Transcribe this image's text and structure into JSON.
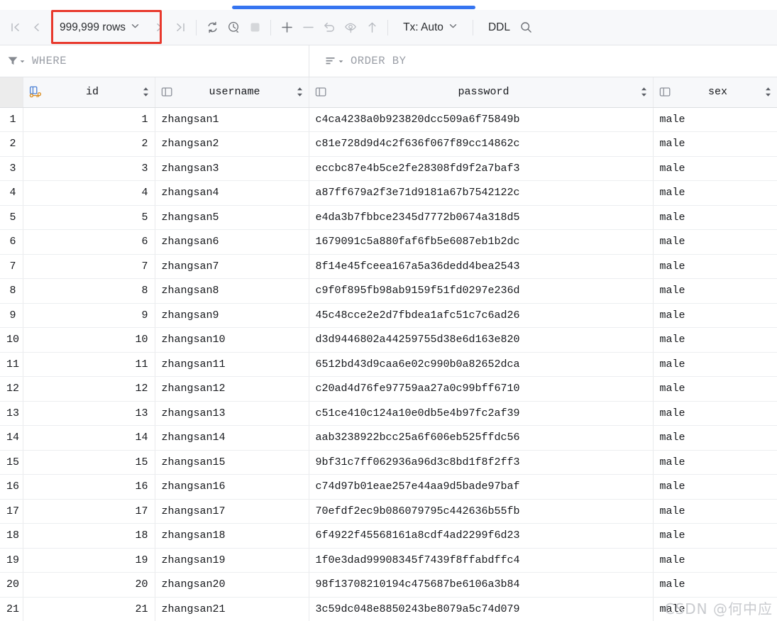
{
  "toolbar": {
    "nav_first": "first-page",
    "nav_prev": "previous-page",
    "rows_label": "999,999 rows",
    "rows_caret": "⌄",
    "nav_next": "next-page",
    "nav_last": "last-page",
    "refresh": "refresh",
    "history": "history",
    "stop": "stop",
    "add_row": "+",
    "remove_row": "−",
    "revert": "revert",
    "preview": "preview-changes",
    "submit": "submit",
    "tx_label": "Tx: Auto",
    "tx_caret": "⌄",
    "ddl_label": "DDL",
    "search": "search",
    "highlight_color": "#e8382c",
    "progress_color": "#3574f0"
  },
  "filters": {
    "where_label": "WHERE",
    "order_by_label": "ORDER BY"
  },
  "table": {
    "gutter_header": "",
    "columns": [
      {
        "name": "id",
        "icon": "primary-key-icon",
        "sortable": true,
        "align": "right"
      },
      {
        "name": "username",
        "icon": "column-icon",
        "sortable": true,
        "align": "left"
      },
      {
        "name": "password",
        "icon": "column-icon",
        "sortable": true,
        "align": "left"
      },
      {
        "name": "sex",
        "icon": "column-icon",
        "sortable": true,
        "align": "left"
      }
    ],
    "rows": [
      {
        "n": "1",
        "id": "1",
        "username": "zhangsan1",
        "password": "c4ca4238a0b923820dcc509a6f75849b",
        "sex": "male"
      },
      {
        "n": "2",
        "id": "2",
        "username": "zhangsan2",
        "password": "c81e728d9d4c2f636f067f89cc14862c",
        "sex": "male"
      },
      {
        "n": "3",
        "id": "3",
        "username": "zhangsan3",
        "password": "eccbc87e4b5ce2fe28308fd9f2a7baf3",
        "sex": "male"
      },
      {
        "n": "4",
        "id": "4",
        "username": "zhangsan4",
        "password": "a87ff679a2f3e71d9181a67b7542122c",
        "sex": "male"
      },
      {
        "n": "5",
        "id": "5",
        "username": "zhangsan5",
        "password": "e4da3b7fbbce2345d7772b0674a318d5",
        "sex": "male"
      },
      {
        "n": "6",
        "id": "6",
        "username": "zhangsan6",
        "password": "1679091c5a880faf6fb5e6087eb1b2dc",
        "sex": "male"
      },
      {
        "n": "7",
        "id": "7",
        "username": "zhangsan7",
        "password": "8f14e45fceea167a5a36dedd4bea2543",
        "sex": "male"
      },
      {
        "n": "8",
        "id": "8",
        "username": "zhangsan8",
        "password": "c9f0f895fb98ab9159f51fd0297e236d",
        "sex": "male"
      },
      {
        "n": "9",
        "id": "9",
        "username": "zhangsan9",
        "password": "45c48cce2e2d7fbdea1afc51c7c6ad26",
        "sex": "male"
      },
      {
        "n": "10",
        "id": "10",
        "username": "zhangsan10",
        "password": "d3d9446802a44259755d38e6d163e820",
        "sex": "male"
      },
      {
        "n": "11",
        "id": "11",
        "username": "zhangsan11",
        "password": "6512bd43d9caa6e02c990b0a82652dca",
        "sex": "male"
      },
      {
        "n": "12",
        "id": "12",
        "username": "zhangsan12",
        "password": "c20ad4d76fe97759aa27a0c99bff6710",
        "sex": "male"
      },
      {
        "n": "13",
        "id": "13",
        "username": "zhangsan13",
        "password": "c51ce410c124a10e0db5e4b97fc2af39",
        "sex": "male"
      },
      {
        "n": "14",
        "id": "14",
        "username": "zhangsan14",
        "password": "aab3238922bcc25a6f606eb525ffdc56",
        "sex": "male"
      },
      {
        "n": "15",
        "id": "15",
        "username": "zhangsan15",
        "password": "9bf31c7ff062936a96d3c8bd1f8f2ff3",
        "sex": "male"
      },
      {
        "n": "16",
        "id": "16",
        "username": "zhangsan16",
        "password": "c74d97b01eae257e44aa9d5bade97baf",
        "sex": "male"
      },
      {
        "n": "17",
        "id": "17",
        "username": "zhangsan17",
        "password": "70efdf2ec9b086079795c442636b55fb",
        "sex": "male"
      },
      {
        "n": "18",
        "id": "18",
        "username": "zhangsan18",
        "password": "6f4922f45568161a8cdf4ad2299f6d23",
        "sex": "male"
      },
      {
        "n": "19",
        "id": "19",
        "username": "zhangsan19",
        "password": "1f0e3dad99908345f7439f8ffabdffc4",
        "sex": "male"
      },
      {
        "n": "20",
        "id": "20",
        "username": "zhangsan20",
        "password": "98f13708210194c475687be6106a3b84",
        "sex": "male"
      },
      {
        "n": "21",
        "id": "21",
        "username": "zhangsan21",
        "password": "3c59dc048e8850243be8079a5c74d079",
        "sex": "male"
      }
    ]
  },
  "watermark": {
    "text": "CSDN @何中应"
  }
}
